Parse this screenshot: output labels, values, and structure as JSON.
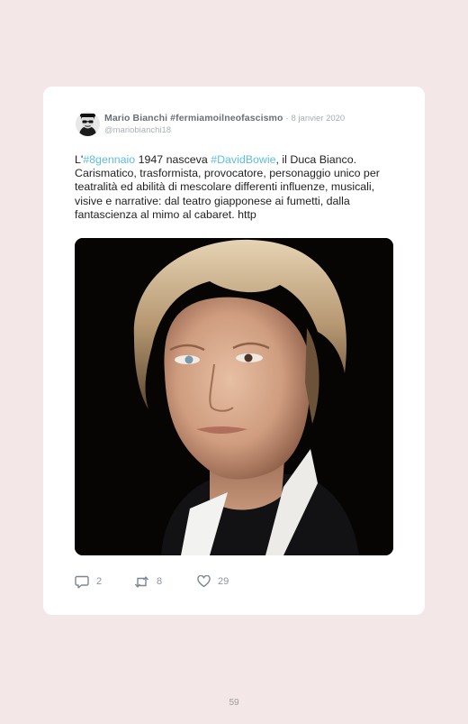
{
  "tweet": {
    "author_name": "Mario Bianchi #fermiamoilneofascismo",
    "separator": "·",
    "date": "8 janvier 2020",
    "handle": "@mariobianchi18",
    "text": {
      "t1": "L'",
      "hashtag1": "#8gennaio",
      "t2": " 1947 nasceva ",
      "hashtag2": "#DavidBowie",
      "t3": ", il Duca Bianco. Carismatico, trasformista, provocatore, personaggio unico per teatralità ed abilità di mescolare differenti influenze, musicali, visive e narrative: dal teatro giapponese ai fumetti, dalla fantascienza al mimo al cabaret. http"
    },
    "actions": {
      "reply_count": "2",
      "retweet_count": "8",
      "like_count": "29"
    },
    "colors": {
      "hashtag": "#5cbde5",
      "author": "#6a6f78"
    }
  },
  "page": {
    "number": "59"
  }
}
